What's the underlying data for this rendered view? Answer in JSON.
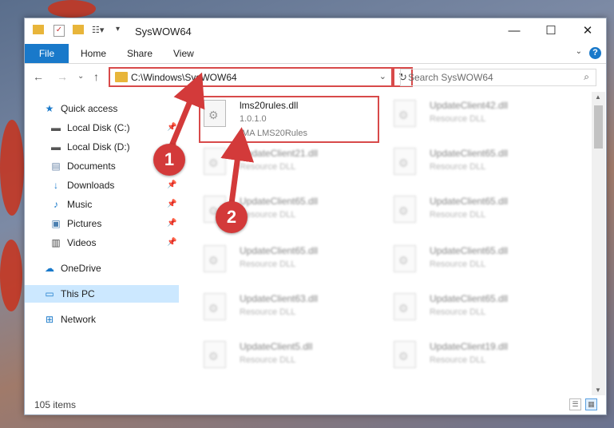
{
  "window": {
    "title": "SysWOW64"
  },
  "ribbon": {
    "tabs": [
      "File",
      "Home",
      "Share",
      "View"
    ],
    "help": "?"
  },
  "address": {
    "path": "C:\\Windows\\SysWOW64"
  },
  "search": {
    "placeholder": "Search SysWOW64"
  },
  "sidebar": {
    "items": [
      {
        "label": "Quick access",
        "icon": "star-icon",
        "pinned": false
      },
      {
        "label": "Local Disk (C:)",
        "icon": "drive-icon",
        "pinned": true
      },
      {
        "label": "Local Disk (D:)",
        "icon": "drive-icon",
        "pinned": true
      },
      {
        "label": "Documents",
        "icon": "document-icon",
        "pinned": true
      },
      {
        "label": "Downloads",
        "icon": "download-icon",
        "pinned": true
      },
      {
        "label": "Music",
        "icon": "music-icon",
        "pinned": true
      },
      {
        "label": "Pictures",
        "icon": "pictures-icon",
        "pinned": true
      },
      {
        "label": "Videos",
        "icon": "videos-icon",
        "pinned": true
      },
      {
        "label": "OneDrive",
        "icon": "cloud-icon",
        "pinned": false
      },
      {
        "label": "This PC",
        "icon": "computer-icon",
        "pinned": false
      },
      {
        "label": "Network",
        "icon": "network-icon",
        "pinned": false
      }
    ]
  },
  "files": [
    {
      "name": "lms20rules.dll",
      "line2": "1.0.1.0",
      "line3": "IMA LMS20Rules"
    },
    {
      "name": "UpdateClient42.dll",
      "line2": "Resource DLL"
    },
    {
      "name": "UpdateClient21.dll",
      "line2": "Resource DLL"
    },
    {
      "name": "UpdateClient65.dll",
      "line2": "Resource DLL"
    },
    {
      "name": "UpdateClient65.dll",
      "line2": "Resource DLL"
    },
    {
      "name": "UpdateClient65.dll",
      "line2": "Resource DLL"
    },
    {
      "name": "UpdateClient65.dll",
      "line2": "Resource DLL"
    },
    {
      "name": "UpdateClient65.dll",
      "line2": "Resource DLL"
    },
    {
      "name": "UpdateClient63.dll",
      "line2": "Resource DLL"
    },
    {
      "name": "UpdateClient65.dll",
      "line2": "Resource DLL"
    },
    {
      "name": "UpdateClient5.dll",
      "line2": "Resource DLL"
    },
    {
      "name": "UpdateClient19.dll",
      "line2": "Resource DLL"
    }
  ],
  "status": {
    "item_count": "105 items"
  },
  "annotations": {
    "marker1": "1",
    "marker2": "2"
  },
  "colors": {
    "accent": "#1979ca",
    "highlight": "#d84a4a",
    "selected": "#cce8ff"
  }
}
